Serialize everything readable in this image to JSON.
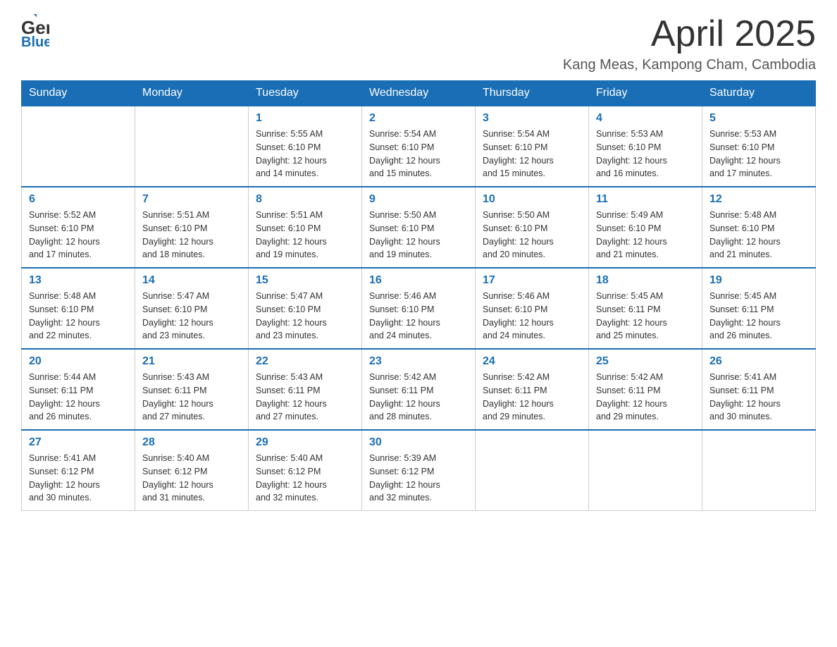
{
  "logo": {
    "text_general": "General",
    "text_blue": "Blue"
  },
  "title": {
    "month_year": "April 2025",
    "location": "Kang Meas, Kampong Cham, Cambodia"
  },
  "calendar": {
    "days_of_week": [
      "Sunday",
      "Monday",
      "Tuesday",
      "Wednesday",
      "Thursday",
      "Friday",
      "Saturday"
    ],
    "weeks": [
      [
        {
          "day": "",
          "info": ""
        },
        {
          "day": "",
          "info": ""
        },
        {
          "day": "1",
          "info": "Sunrise: 5:55 AM\nSunset: 6:10 PM\nDaylight: 12 hours\nand 14 minutes."
        },
        {
          "day": "2",
          "info": "Sunrise: 5:54 AM\nSunset: 6:10 PM\nDaylight: 12 hours\nand 15 minutes."
        },
        {
          "day": "3",
          "info": "Sunrise: 5:54 AM\nSunset: 6:10 PM\nDaylight: 12 hours\nand 15 minutes."
        },
        {
          "day": "4",
          "info": "Sunrise: 5:53 AM\nSunset: 6:10 PM\nDaylight: 12 hours\nand 16 minutes."
        },
        {
          "day": "5",
          "info": "Sunrise: 5:53 AM\nSunset: 6:10 PM\nDaylight: 12 hours\nand 17 minutes."
        }
      ],
      [
        {
          "day": "6",
          "info": "Sunrise: 5:52 AM\nSunset: 6:10 PM\nDaylight: 12 hours\nand 17 minutes."
        },
        {
          "day": "7",
          "info": "Sunrise: 5:51 AM\nSunset: 6:10 PM\nDaylight: 12 hours\nand 18 minutes."
        },
        {
          "day": "8",
          "info": "Sunrise: 5:51 AM\nSunset: 6:10 PM\nDaylight: 12 hours\nand 19 minutes."
        },
        {
          "day": "9",
          "info": "Sunrise: 5:50 AM\nSunset: 6:10 PM\nDaylight: 12 hours\nand 19 minutes."
        },
        {
          "day": "10",
          "info": "Sunrise: 5:50 AM\nSunset: 6:10 PM\nDaylight: 12 hours\nand 20 minutes."
        },
        {
          "day": "11",
          "info": "Sunrise: 5:49 AM\nSunset: 6:10 PM\nDaylight: 12 hours\nand 21 minutes."
        },
        {
          "day": "12",
          "info": "Sunrise: 5:48 AM\nSunset: 6:10 PM\nDaylight: 12 hours\nand 21 minutes."
        }
      ],
      [
        {
          "day": "13",
          "info": "Sunrise: 5:48 AM\nSunset: 6:10 PM\nDaylight: 12 hours\nand 22 minutes."
        },
        {
          "day": "14",
          "info": "Sunrise: 5:47 AM\nSunset: 6:10 PM\nDaylight: 12 hours\nand 23 minutes."
        },
        {
          "day": "15",
          "info": "Sunrise: 5:47 AM\nSunset: 6:10 PM\nDaylight: 12 hours\nand 23 minutes."
        },
        {
          "day": "16",
          "info": "Sunrise: 5:46 AM\nSunset: 6:10 PM\nDaylight: 12 hours\nand 24 minutes."
        },
        {
          "day": "17",
          "info": "Sunrise: 5:46 AM\nSunset: 6:10 PM\nDaylight: 12 hours\nand 24 minutes."
        },
        {
          "day": "18",
          "info": "Sunrise: 5:45 AM\nSunset: 6:11 PM\nDaylight: 12 hours\nand 25 minutes."
        },
        {
          "day": "19",
          "info": "Sunrise: 5:45 AM\nSunset: 6:11 PM\nDaylight: 12 hours\nand 26 minutes."
        }
      ],
      [
        {
          "day": "20",
          "info": "Sunrise: 5:44 AM\nSunset: 6:11 PM\nDaylight: 12 hours\nand 26 minutes."
        },
        {
          "day": "21",
          "info": "Sunrise: 5:43 AM\nSunset: 6:11 PM\nDaylight: 12 hours\nand 27 minutes."
        },
        {
          "day": "22",
          "info": "Sunrise: 5:43 AM\nSunset: 6:11 PM\nDaylight: 12 hours\nand 27 minutes."
        },
        {
          "day": "23",
          "info": "Sunrise: 5:42 AM\nSunset: 6:11 PM\nDaylight: 12 hours\nand 28 minutes."
        },
        {
          "day": "24",
          "info": "Sunrise: 5:42 AM\nSunset: 6:11 PM\nDaylight: 12 hours\nand 29 minutes."
        },
        {
          "day": "25",
          "info": "Sunrise: 5:42 AM\nSunset: 6:11 PM\nDaylight: 12 hours\nand 29 minutes."
        },
        {
          "day": "26",
          "info": "Sunrise: 5:41 AM\nSunset: 6:11 PM\nDaylight: 12 hours\nand 30 minutes."
        }
      ],
      [
        {
          "day": "27",
          "info": "Sunrise: 5:41 AM\nSunset: 6:12 PM\nDaylight: 12 hours\nand 30 minutes."
        },
        {
          "day": "28",
          "info": "Sunrise: 5:40 AM\nSunset: 6:12 PM\nDaylight: 12 hours\nand 31 minutes."
        },
        {
          "day": "29",
          "info": "Sunrise: 5:40 AM\nSunset: 6:12 PM\nDaylight: 12 hours\nand 32 minutes."
        },
        {
          "day": "30",
          "info": "Sunrise: 5:39 AM\nSunset: 6:12 PM\nDaylight: 12 hours\nand 32 minutes."
        },
        {
          "day": "",
          "info": ""
        },
        {
          "day": "",
          "info": ""
        },
        {
          "day": "",
          "info": ""
        }
      ]
    ]
  }
}
